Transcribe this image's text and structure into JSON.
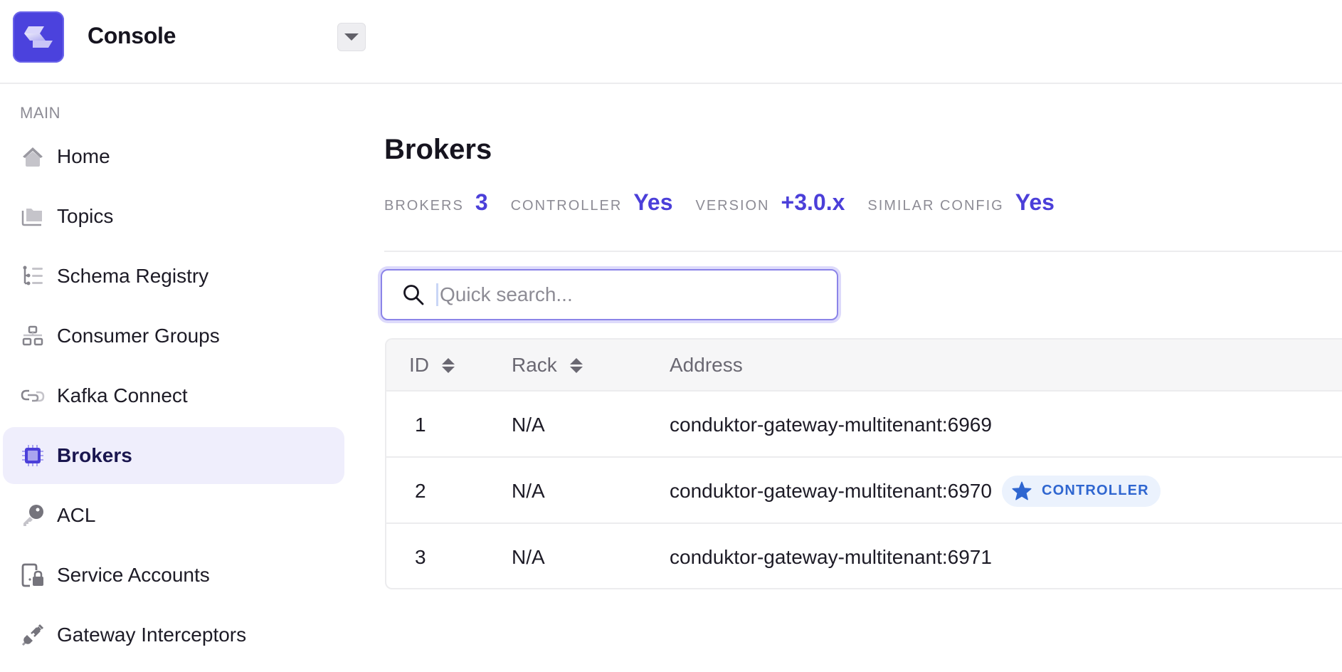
{
  "header": {
    "app_title": "Console",
    "logo_icon": "conduktor-logo",
    "dropdown_icon": "caret-down-icon"
  },
  "sidebar": {
    "section_label": "MAIN",
    "items": [
      {
        "label": "Home",
        "icon": "home-icon",
        "active": false
      },
      {
        "label": "Topics",
        "icon": "folder-icon",
        "active": false
      },
      {
        "label": "Schema Registry",
        "icon": "schema-tree-icon",
        "active": false
      },
      {
        "label": "Consumer Groups",
        "icon": "network-groups-icon",
        "active": false
      },
      {
        "label": "Kafka Connect",
        "icon": "link-icon",
        "active": false
      },
      {
        "label": "Brokers",
        "icon": "chip-icon",
        "active": true
      },
      {
        "label": "ACL",
        "icon": "key-icon",
        "active": false
      },
      {
        "label": "Service Accounts",
        "icon": "device-lock-icon",
        "active": false
      },
      {
        "label": "Gateway Interceptors",
        "icon": "plug-icon",
        "active": false
      }
    ]
  },
  "main": {
    "title": "Brokers",
    "stats": [
      {
        "label": "BROKERS",
        "value": "3"
      },
      {
        "label": "CONTROLLER",
        "value": "Yes"
      },
      {
        "label": "VERSION",
        "value": "+3.0.x"
      },
      {
        "label": "SIMILAR CONFIG",
        "value": "Yes"
      }
    ],
    "search": {
      "placeholder": "Quick search...",
      "value": ""
    },
    "table": {
      "columns": [
        {
          "label": "ID",
          "sortable": true
        },
        {
          "label": "Rack",
          "sortable": true
        },
        {
          "label": "Address",
          "sortable": false
        }
      ],
      "rows": [
        {
          "id": "1",
          "rack": "N/A",
          "address": "conduktor-gateway-multitenant:6969",
          "badge": null
        },
        {
          "id": "2",
          "rack": "N/A",
          "address": "conduktor-gateway-multitenant:6970",
          "badge": "CONTROLLER"
        },
        {
          "id": "3",
          "rack": "N/A",
          "address": "conduktor-gateway-multitenant:6971",
          "badge": null
        }
      ]
    }
  },
  "colors": {
    "accent": "#4b3fd9",
    "active_nav_bg": "#efeefc",
    "badge_bg": "#ebf2fd",
    "badge_text": "#2f66d0",
    "muted_text": "#8d8c95"
  }
}
